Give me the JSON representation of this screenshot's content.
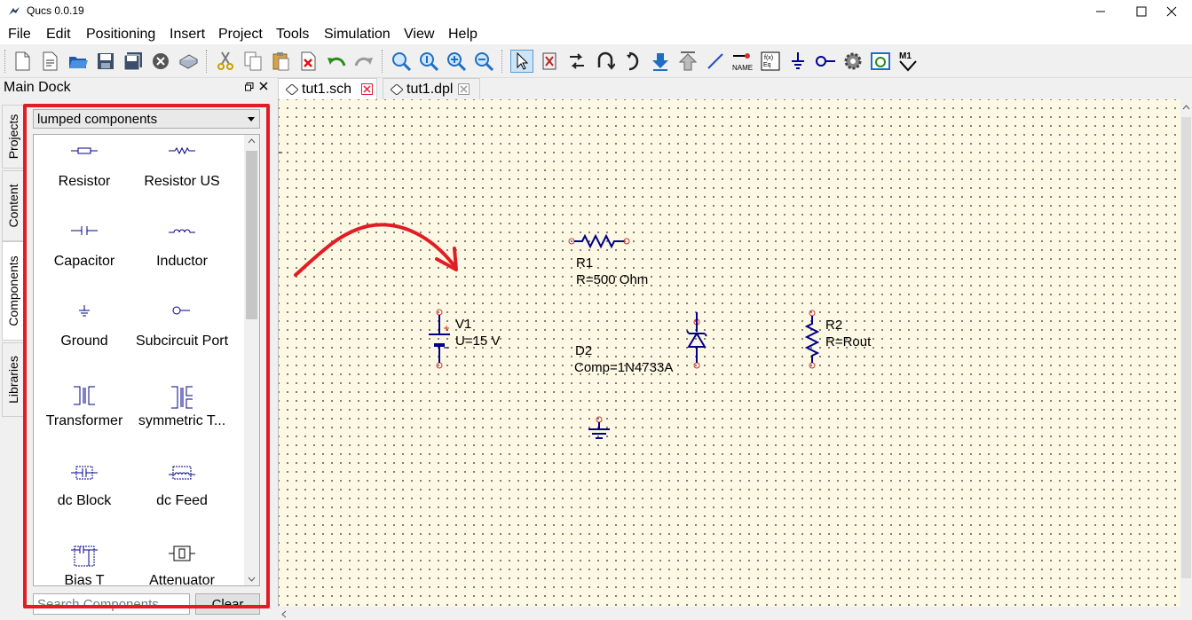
{
  "window": {
    "title": "Qucs 0.0.19"
  },
  "menu": [
    "File",
    "Edit",
    "Positioning",
    "Insert",
    "Project",
    "Tools",
    "Simulation",
    "View",
    "Help"
  ],
  "toolbar": {
    "buttons": [
      "new-file-icon",
      "new-text-icon",
      "open-icon",
      "save-icon",
      "save-all-icon",
      "close-icon",
      "print-icon",
      "cut-icon",
      "copy-icon",
      "paste-icon",
      "delete-icon",
      "undo-icon",
      "redo-icon",
      "zoom-fit-icon",
      "zoom-1-icon",
      "zoom-in-icon",
      "zoom-out-icon",
      "select-icon",
      "mirror-x-icon",
      "mirror-y-icon",
      "rotate-icon",
      "enter-subcircuit-icon",
      "exit-subcircuit-icon",
      "push-up-icon",
      "wire-icon",
      "wire-label-icon",
      "equation-icon",
      "ground-icon",
      "port-icon",
      "simulate-icon",
      "view-results-icon",
      "marker-icon"
    ],
    "name_label": "NAME",
    "marker_label": "M1"
  },
  "dock": {
    "title": "Main Dock",
    "side_tabs": [
      "Projects",
      "Content",
      "Components",
      "Libraries"
    ],
    "category": "lumped components",
    "components": [
      "Resistor",
      "Resistor US",
      "Capacitor",
      "Inductor",
      "Ground",
      "Subcircuit Port",
      "Transformer",
      "symmetric T...",
      "dc Block",
      "dc Feed",
      "Bias T",
      "Attenuator"
    ],
    "search_placeholder": "Search Components",
    "clear_label": "Clear"
  },
  "tabs": [
    {
      "label": "tut1.sch",
      "active": true
    },
    {
      "label": "tut1.dpl",
      "active": false
    }
  ],
  "schematic": {
    "v1_name": "V1",
    "v1_value": "U=15 V",
    "r1_name": "R1",
    "r1_value": "R=500 Ohm",
    "d2_name": "D2",
    "d2_value": "Comp=1N4733A",
    "r2_name": "R2",
    "r2_value": "R=Rout"
  },
  "colors": {
    "highlight": "#e21c24",
    "canvas": "#fcf8e3",
    "wire": "#00008b",
    "node": "#d32f2f"
  }
}
